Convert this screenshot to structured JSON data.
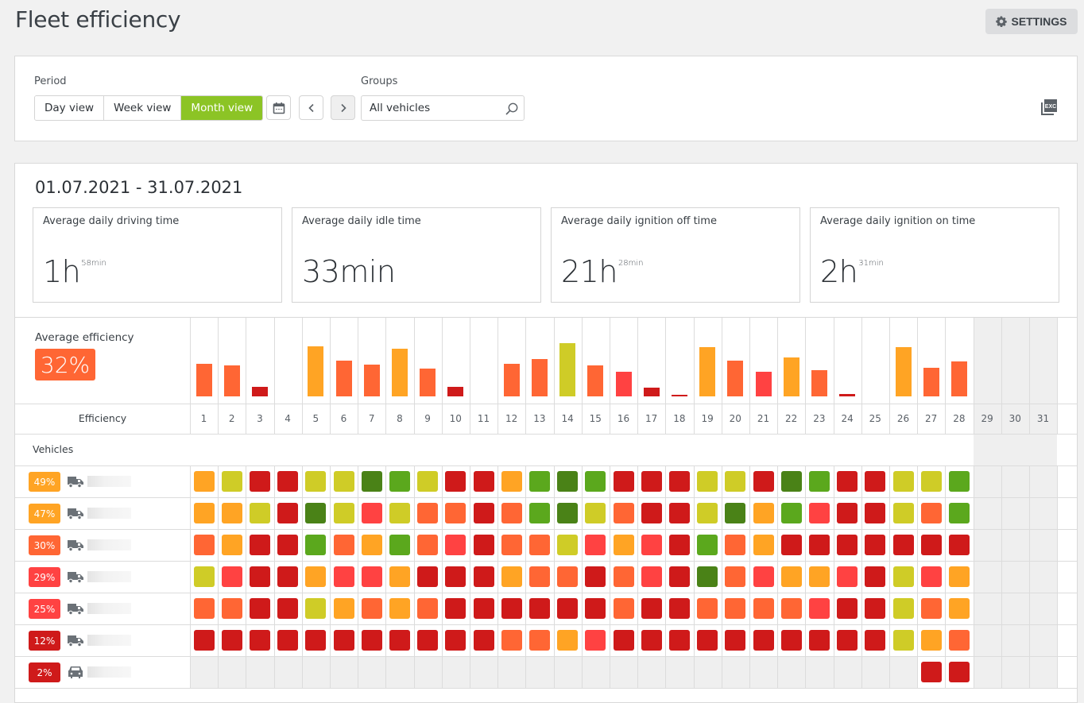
{
  "header": {
    "title": "Fleet efficiency",
    "settings_label": "SETTINGS"
  },
  "filters": {
    "period_label": "Period",
    "period_options": [
      "Day view",
      "Week view",
      "Month view"
    ],
    "active_period": "Month view",
    "groups_label": "Groups",
    "groups_value": "All vehicles",
    "export_icon": "excel-export-icon"
  },
  "summary": {
    "date_range": "01.07.2021 - 31.07.2021",
    "stats": [
      {
        "label": "Average daily driving time",
        "value": "1h",
        "sup": "58min"
      },
      {
        "label": "Average daily idle time",
        "value": "33min",
        "sup": ""
      },
      {
        "label": "Average daily ignition off time",
        "value": "21h",
        "sup": "28min"
      },
      {
        "label": "Average daily ignition on time",
        "value": "2h",
        "sup": "31min"
      }
    ]
  },
  "efficiency": {
    "avg_label": "Average efficiency",
    "avg_value": "32%",
    "avg_color": "#ff6634",
    "row_label": "Efficiency",
    "vehicles_label": "Vehicles"
  },
  "palette": {
    "O": "#ffa424",
    "Y": "#cfcc27",
    "R": "#cf1a1a",
    "LR": "#ff4242",
    "OR": "#ff6634",
    "G": "#5ba81d",
    "DG": "#4a8217"
  },
  "chart_data": {
    "type": "bar",
    "title": "Average efficiency per day",
    "xlabel": "Efficiency",
    "ylabel": "",
    "categories": [
      "1",
      "2",
      "3",
      "4",
      "5",
      "6",
      "7",
      "8",
      "9",
      "10",
      "11",
      "12",
      "13",
      "14",
      "15",
      "16",
      "17",
      "18",
      "19",
      "20",
      "21",
      "22",
      "23",
      "24",
      "25",
      "26",
      "27",
      "28",
      "29",
      "30",
      "31"
    ],
    "values": [
      41,
      39,
      12,
      0,
      63,
      45,
      40,
      60,
      35,
      12,
      0,
      41,
      47,
      67,
      39,
      31,
      11,
      1,
      62,
      45,
      31,
      49,
      33,
      3,
      0,
      62,
      36,
      44,
      null,
      null,
      null
    ],
    "colors": [
      "OR",
      "OR",
      "R",
      "R",
      "O",
      "OR",
      "OR",
      "O",
      "OR",
      "R",
      "R",
      "OR",
      "OR",
      "Y",
      "OR",
      "LR",
      "R",
      "R",
      "O",
      "OR",
      "LR",
      "O",
      "OR",
      "R",
      "R",
      "O",
      "OR",
      "OR",
      null,
      null,
      null
    ],
    "disabled_days": [
      "29",
      "30",
      "31"
    ],
    "ylim": [
      0,
      100
    ],
    "grid": true
  },
  "vehicles": [
    {
      "efficiency": "49%",
      "color": "O",
      "type": "van-icon",
      "days": [
        "O",
        "Y",
        "R",
        "R",
        "Y",
        "Y",
        "DG",
        "G",
        "Y",
        "R",
        "R",
        "O",
        "G",
        "DG",
        "G",
        "R",
        "R",
        "R",
        "Y",
        "Y",
        "R",
        "DG",
        "G",
        "R",
        "R",
        "Y",
        "Y",
        "G"
      ]
    },
    {
      "efficiency": "47%",
      "color": "O",
      "type": "van-icon",
      "days": [
        "O",
        "O",
        "Y",
        "R",
        "DG",
        "Y",
        "LR",
        "Y",
        "OR",
        "OR",
        "R",
        "OR",
        "G",
        "DG",
        "Y",
        "OR",
        "R",
        "R",
        "Y",
        "DG",
        "O",
        "G",
        "LR",
        "R",
        "R",
        "Y",
        "OR",
        "G"
      ]
    },
    {
      "efficiency": "30%",
      "color": "OR",
      "type": "van-icon",
      "days": [
        "OR",
        "O",
        "R",
        "R",
        "G",
        "OR",
        "O",
        "G",
        "OR",
        "LR",
        "R",
        "OR",
        "OR",
        "Y",
        "LR",
        "O",
        "LR",
        "R",
        "G",
        "OR",
        "O",
        "R",
        "R",
        "R",
        "R",
        "R",
        "R",
        "R"
      ]
    },
    {
      "efficiency": "29%",
      "color": "LR",
      "type": "van-icon",
      "days": [
        "Y",
        "LR",
        "R",
        "R",
        "O",
        "LR",
        "LR",
        "O",
        "R",
        "R",
        "R",
        "O",
        "OR",
        "OR",
        "R",
        "OR",
        "LR",
        "R",
        "DG",
        "OR",
        "LR",
        "O",
        "O",
        "LR",
        "R",
        "Y",
        "LR",
        "O"
      ]
    },
    {
      "efficiency": "25%",
      "color": "LR",
      "type": "van-icon",
      "days": [
        "OR",
        "OR",
        "R",
        "R",
        "Y",
        "O",
        "OR",
        "O",
        "OR",
        "R",
        "R",
        "R",
        "R",
        "R",
        "R",
        "OR",
        "R",
        "R",
        "OR",
        "OR",
        "OR",
        "OR",
        "LR",
        "R",
        "R",
        "Y",
        "OR",
        "O"
      ]
    },
    {
      "efficiency": "12%",
      "color": "R",
      "type": "van-icon",
      "days": [
        "R",
        "R",
        "R",
        "R",
        "R",
        "R",
        "R",
        "R",
        "R",
        "R",
        "R",
        "OR",
        "OR",
        "O",
        "LR",
        "R",
        "R",
        "R",
        "R",
        "R",
        "R",
        "R",
        "R",
        "R",
        "R",
        "Y",
        "O",
        "OR"
      ]
    },
    {
      "efficiency": "2%",
      "color": "R",
      "type": "car-icon",
      "days": [
        null,
        null,
        null,
        null,
        null,
        null,
        null,
        null,
        null,
        null,
        null,
        null,
        null,
        null,
        null,
        null,
        null,
        null,
        null,
        null,
        null,
        null,
        null,
        null,
        null,
        null,
        "R",
        "R"
      ]
    }
  ]
}
